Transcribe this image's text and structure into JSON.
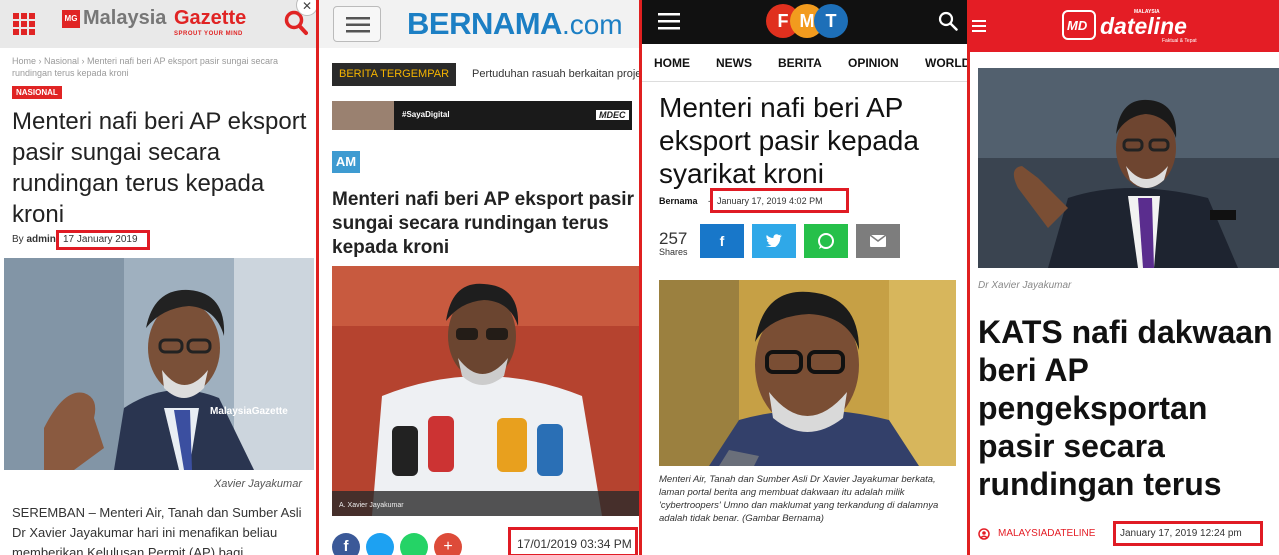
{
  "gazette": {
    "logo_prefix": "Malaysia",
    "logo_main": "Gazette",
    "logo_badge": "MG",
    "tagline": "SPROUT YOUR MIND",
    "breadcrumb": "Home  ›  Nasional  ›  Menteri nafi beri AP eksport pasir sungai secara rundingan terus kepada kroni",
    "category": "NASIONAL",
    "headline": "Menteri nafi beri AP eksport pasir sungai secara rundingan terus kepada kroni",
    "by_prefix": "By",
    "author": "admin",
    "date": "17 January 2019",
    "photo_watermark": "MalaysiaGazette",
    "caption": "Xavier Jayakumar",
    "body": "SEREMBAN – Menteri Air, Tanah dan Sumber Asli Dr Xavier Jayakumar hari ini menafikan beliau memberikan Kelulusan Permit (AP) bagi",
    "close_glyph": "✕"
  },
  "bernama": {
    "logo_main": "BERNAMA",
    "logo_suffix": ".com",
    "breaking_label": "BERITA TERGEMPAR",
    "breaking_text": "Pertuduhan rasuah berkaitan projek",
    "ad_text": "#SayaDigital",
    "ad_brand": "MDEC",
    "section": "AM",
    "headline": "Menteri nafi beri AP eksport pasir sungai secara rundingan terus kepada kroni",
    "photo_caption": "A. Xavier Jayakumar",
    "date": "17/01/2019 03:34 PM"
  },
  "fmt": {
    "logo_letters": [
      "F",
      "M",
      "T"
    ],
    "nav": [
      "HOME",
      "NEWS",
      "BERITA",
      "OPINION",
      "WORLD"
    ],
    "headline": "Menteri nafi beri AP eksport pasir kepada syarikat kroni",
    "author": "Bernama",
    "separator": "-",
    "date": "January 17, 2019 4:02 PM",
    "shares_count": "257",
    "shares_label": "Shares",
    "caption": "Menteri Air, Tanah dan Sumber Asli Dr Xavier Jayakumar berkata, laman portal berita ang membuat dakwaan itu adalah milik 'cybertroopers' Umno dan maklumat yang terkandung di dalamnya adalah tidak benar. (Gambar Bernama)"
  },
  "dateline": {
    "logo_badge": "MD",
    "logo_main": "dateline",
    "logo_top": "MALAYSIA",
    "logo_bottom": "Faktual & Tepat",
    "caption": "Dr Xavier Jayakumar",
    "headline": "KATS nafi dakwaan beri AP pengeksportan pasir secara rundingan terus",
    "source": "MALAYSIADATELINE",
    "date": "January 17, 2019 12:24 pm"
  },
  "colors": {
    "highlight_box": "#e01b24",
    "gazette_red": "#e02424",
    "bernama_blue": "#1c7fc4",
    "fmt_red": "#e0301e",
    "fmt_blue": "#1d6fb8",
    "dateline_red": "#e41d25",
    "facebook": "#1877c9",
    "twitter": "#2fa8e8",
    "whatsapp": "#26c04a",
    "email": "#7d7d7d"
  }
}
